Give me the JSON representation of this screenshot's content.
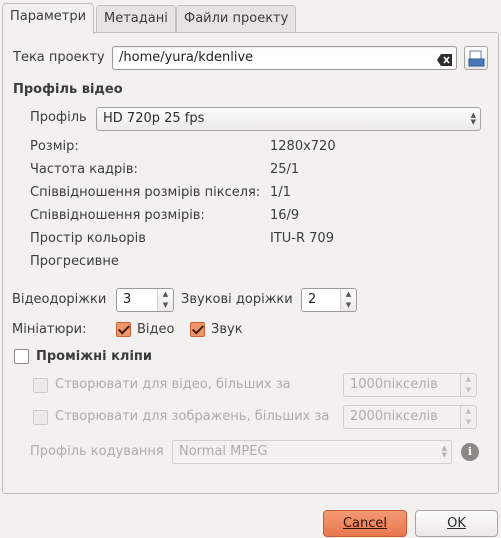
{
  "tabs": [
    "Параметри",
    "Метадані",
    "Файли проекту"
  ],
  "project_folder": {
    "label": "Тека проекту",
    "value": "/home/yura/kdenlive"
  },
  "video_profile": {
    "heading": "Профіль відео",
    "profile_label": "Профіль",
    "profile_value": "HD 720p 25 fps",
    "size_label": "Розмір:",
    "size_value": "1280x720",
    "fps_label": "Частота кадрів:",
    "fps_value": "25/1",
    "pixel_ratio_label": "Співвідношення розмірів пікселя:",
    "pixel_ratio_value": "1/1",
    "aspect_label": "Співвідношення розмірів:",
    "aspect_value": "16/9",
    "colorspace_label": "Простір кольорів",
    "colorspace_value": "ITU-R 709",
    "progressive_label": "Прогресивне"
  },
  "tracks": {
    "video_label": "Відеодоріжки",
    "video_value": "3",
    "audio_label": "Звукові доріжки",
    "audio_value": "2"
  },
  "thumbnails": {
    "label": "Мініатюри:",
    "video_label": "Відео",
    "video_checked": true,
    "audio_label": "Звук",
    "audio_checked": true
  },
  "proxy": {
    "heading": "Проміжні кліпи",
    "enabled": false,
    "video_label": "Створювати для відео, більших за",
    "video_value": "1000пікселів",
    "image_label": "Створювати для зображень, більших за",
    "image_value": "2000пікселів",
    "encoding_label": "Профіль кодування",
    "encoding_value": "Normal MPEG"
  },
  "buttons": {
    "cancel": "Cancel",
    "ok": "OK"
  },
  "colors": {
    "accent": "#e9764c",
    "check_fill": "#f0956a"
  }
}
